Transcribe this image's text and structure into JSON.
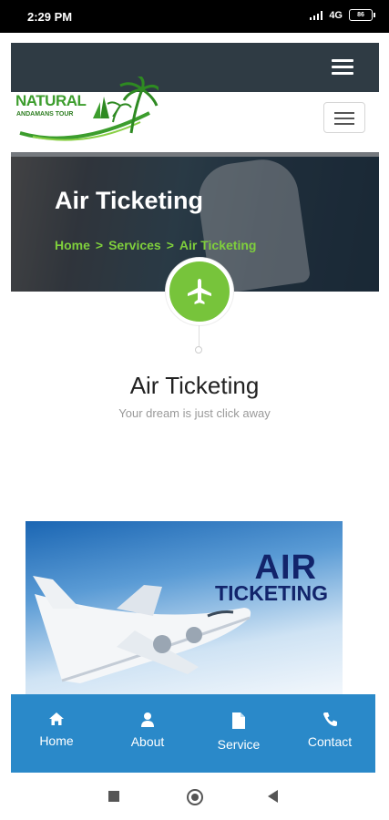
{
  "status_bar": {
    "time": "2:29 PM",
    "network": "4G",
    "battery": "86"
  },
  "logo": {
    "name": "NATURAL",
    "tagline": "ANDAMANS TOUR"
  },
  "banner": {
    "title": "Air Ticketing",
    "breadcrumb": [
      "Home",
      "Services",
      "Air Ticketing"
    ],
    "separator": ">"
  },
  "section": {
    "title": "Air Ticketing",
    "subtitle": "Your dream is just click away"
  },
  "promo": {
    "line1": "AIR",
    "line2": "TICKETING"
  },
  "bottom_nav": [
    {
      "label": "Home",
      "icon": "home-icon"
    },
    {
      "label": "About",
      "icon": "user-icon"
    },
    {
      "label": "Service",
      "icon": "file-icon"
    },
    {
      "label": "Contact",
      "icon": "phone-icon"
    }
  ],
  "colors": {
    "accent_green": "#77c43b",
    "nav_blue": "#2a89c9",
    "topbar": "#2f3b44",
    "promo_text": "#12246b"
  }
}
